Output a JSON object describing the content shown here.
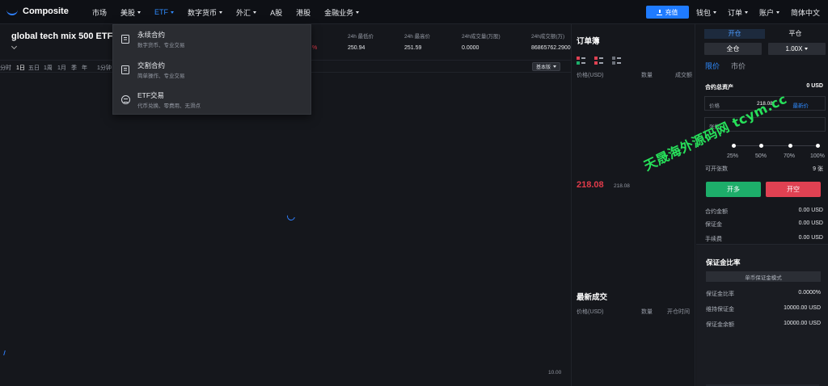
{
  "app": {
    "logo_text": "Composite",
    "accent": "#1f7bff",
    "up_color": "#1dae6a",
    "down_color": "#e04152"
  },
  "nav": {
    "items": [
      {
        "label": "市场",
        "caret": false,
        "active": false
      },
      {
        "label": "美股",
        "caret": true,
        "active": false
      },
      {
        "label": "ETF",
        "caret": true,
        "active": true
      },
      {
        "label": "数字货币",
        "caret": true,
        "active": false
      },
      {
        "label": "外汇",
        "caret": true,
        "active": false
      },
      {
        "label": "A股",
        "caret": false,
        "active": false
      },
      {
        "label": "港股",
        "caret": false,
        "active": false
      },
      {
        "label": "金融业务",
        "caret": true,
        "active": false
      }
    ],
    "recharge_label": "充值",
    "right_items": [
      "钱包",
      "订单",
      "账户",
      "简体中文"
    ]
  },
  "etf_menu": [
    {
      "title": "永续合约",
      "subtitle": "数字货币、专业交易",
      "icon": "contract-icon"
    },
    {
      "title": "交割合约",
      "subtitle": "简单操作、专业交易",
      "icon": "delivery-icon"
    },
    {
      "title": "ETF交易",
      "subtitle": "代币兑换、零费用、无滑点",
      "icon": "exchange-icon"
    }
  ],
  "instrument": {
    "name": "global tech mix 500 ETF",
    "stats": [
      {
        "label": "24h 最低价",
        "value": "250.94"
      },
      {
        "label": "24h 最高价",
        "value": "251.59"
      },
      {
        "label": "24h成交量(万股)",
        "value": "0.0000"
      },
      {
        "label": "24h成交额(万)",
        "value": "86865762.2900"
      }
    ],
    "change_fragment": "%"
  },
  "chart_toolbar": {
    "timeframes": [
      "分时",
      "1日",
      "五日",
      "1周",
      "1月",
      "季",
      "年",
      "1分钟"
    ],
    "active": "1日",
    "version_label": "基本版"
  },
  "chart": {
    "axis_tick": "10.00"
  },
  "orderbook": {
    "title": "订单簿",
    "columns": [
      "价格(USD)",
      "数量",
      "成交额"
    ],
    "last_price": "218.08",
    "mark_price": "218.08"
  },
  "trades": {
    "title": "最新成交",
    "columns": [
      "价格(USD)",
      "数量",
      "开仓时间"
    ]
  },
  "trade_panel": {
    "side_tabs": [
      "开仓",
      "平仓"
    ],
    "margin_mode": "全仓",
    "leverage": "1.00X",
    "order_tabs": [
      "限价",
      "市价"
    ],
    "total_assets_label": "合约总资产",
    "total_assets_value": "0 USD",
    "price_field_label": "价格",
    "price_field_value": "218.08",
    "price_field_link": "最新价",
    "qty_placeholder": "张数",
    "percents": [
      "25%",
      "50%",
      "70%",
      "100%"
    ],
    "open_qty_label": "可开张数",
    "open_qty_value": "9 张",
    "buy_label": "开多",
    "sell_label": "开空",
    "info": [
      {
        "label": "合约金额",
        "value": "0.00 USD"
      },
      {
        "label": "保证金",
        "value": "0.00 USD"
      },
      {
        "label": "手续费",
        "value": "0.00 USD"
      }
    ]
  },
  "margin_panel": {
    "title": "保证金比率",
    "mode_label": "单币保证金模式",
    "rows": [
      {
        "label": "保证金比率",
        "value": "0.0000%"
      },
      {
        "label": "维持保证金",
        "value": "10000.00 USD"
      },
      {
        "label": "保证金余额",
        "value": "10000.00 USD"
      }
    ]
  },
  "watermark": "天晟海外源码网 tcym.cc"
}
